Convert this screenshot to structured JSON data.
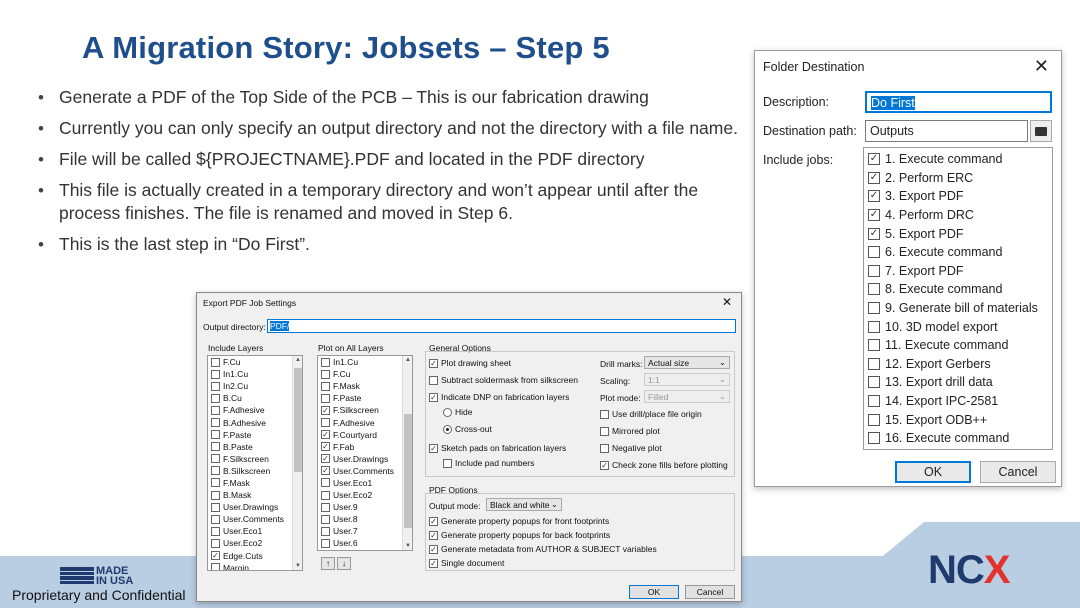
{
  "slide": {
    "title": "A Migration Story: Jobsets – Step 5",
    "bullets": [
      "Generate a PDF of the Top Side of the PCB – This is our fabrication drawing",
      "Currently you can only specify an output directory and not the directory with a file name.",
      "File will be called ${PROJECTNAME}.PDF and located in the PDF directory",
      "This file is actually created in a temporary directory and won’t appear until after the process finishes.  The file is renamed and moved in Step 6.",
      "This is the last step in “Do First”."
    ],
    "footer": {
      "made_line1": "MADE",
      "made_line2": "IN USA",
      "confidential": "Proprietary and Confidential",
      "logo_nc": "NC",
      "logo_x": "X"
    }
  },
  "folder_dialog": {
    "title": "Folder Destination",
    "description_label": "Description:",
    "description_value": "Do First",
    "destination_label": "Destination path:",
    "destination_value": "Outputs",
    "include_label": "Include jobs:",
    "jobs": [
      {
        "label": "1.  Execute command",
        "checked": true
      },
      {
        "label": "2.  Perform ERC",
        "checked": true
      },
      {
        "label": "3.  Export PDF",
        "checked": true
      },
      {
        "label": "4.  Perform DRC",
        "checked": true
      },
      {
        "label": "5.  Export PDF",
        "checked": true
      },
      {
        "label": "6.  Execute command",
        "checked": false
      },
      {
        "label": "7.  Export PDF",
        "checked": false
      },
      {
        "label": "8.  Execute command",
        "checked": false
      },
      {
        "label": "9.  Generate bill of materials",
        "checked": false
      },
      {
        "label": "10.  3D model export",
        "checked": false
      },
      {
        "label": "11.  Execute command",
        "checked": false
      },
      {
        "label": "12.  Export Gerbers",
        "checked": false
      },
      {
        "label": "13.  Export drill data",
        "checked": false
      },
      {
        "label": "14.  Export IPC-2581",
        "checked": false
      },
      {
        "label": "15.  Export ODB++",
        "checked": false
      },
      {
        "label": "16.  Execute command",
        "checked": false
      }
    ],
    "ok_label": "OK",
    "cancel_label": "Cancel"
  },
  "pdf_dialog": {
    "title": "Export PDF Job Settings",
    "output_label": "Output directory:",
    "output_value": "PDF/",
    "include_layers_title": "Include Layers",
    "include_layers": [
      {
        "label": "F.Cu",
        "checked": false
      },
      {
        "label": "In1.Cu",
        "checked": false
      },
      {
        "label": "In2.Cu",
        "checked": false
      },
      {
        "label": "B.Cu",
        "checked": false
      },
      {
        "label": "F.Adhesive",
        "checked": false
      },
      {
        "label": "B.Adhesive",
        "checked": false
      },
      {
        "label": "F.Paste",
        "checked": false
      },
      {
        "label": "B.Paste",
        "checked": false
      },
      {
        "label": "F.Silkscreen",
        "checked": false
      },
      {
        "label": "B.Silkscreen",
        "checked": false
      },
      {
        "label": "F.Mask",
        "checked": false
      },
      {
        "label": "B.Mask",
        "checked": false
      },
      {
        "label": "User.Drawings",
        "checked": false
      },
      {
        "label": "User.Comments",
        "checked": false
      },
      {
        "label": "User.Eco1",
        "checked": false
      },
      {
        "label": "User.Eco2",
        "checked": false
      },
      {
        "label": "Edge.Cuts",
        "checked": true
      },
      {
        "label": "Margin",
        "checked": false
      }
    ],
    "plot_layers_title": "Plot on All Layers",
    "plot_layers": [
      {
        "label": "In1.Cu",
        "checked": false
      },
      {
        "label": "F.Cu",
        "checked": false
      },
      {
        "label": "F.Mask",
        "checked": false
      },
      {
        "label": "F.Paste",
        "checked": false
      },
      {
        "label": "F.Silkscreen",
        "checked": true
      },
      {
        "label": "F.Adhesive",
        "checked": false
      },
      {
        "label": "F.Courtyard",
        "checked": true
      },
      {
        "label": "F.Fab",
        "checked": true
      },
      {
        "label": "User.Drawings",
        "checked": true
      },
      {
        "label": "User.Comments",
        "checked": true
      },
      {
        "label": "User.Eco1",
        "checked": false
      },
      {
        "label": "User.Eco2",
        "checked": false
      },
      {
        "label": "User.9",
        "checked": false
      },
      {
        "label": "User.8",
        "checked": false
      },
      {
        "label": "User.7",
        "checked": false
      },
      {
        "label": "User.6",
        "checked": false
      }
    ],
    "general_title": "General Options",
    "plot_drawing_sheet": "Plot drawing sheet",
    "subtract_soldermask": "Subtract soldermask from silkscreen",
    "indicate_dnp": "Indicate DNP on fabrication layers",
    "hide": "Hide",
    "cross_out": "Cross-out",
    "sketch_pads": "Sketch pads on fabrication layers",
    "include_pad_numbers": "Include pad numbers",
    "drill_marks_label": "Drill marks:",
    "drill_marks_value": "Actual size",
    "scaling_label": "Scaling:",
    "scaling_value": "1:1",
    "plot_mode_label": "Plot mode:",
    "plot_mode_value": "Filled",
    "use_drill_origin": "Use drill/place file origin",
    "mirrored_plot": "Mirrored plot",
    "negative_plot": "Negative plot",
    "check_zone_fills": "Check zone fills before plotting",
    "pdf_title": "PDF Options",
    "output_mode_label": "Output mode:",
    "output_mode_value": "Black and white",
    "popups_front": "Generate property popups for front footprints",
    "popups_back": "Generate property popups for back footprints",
    "metadata": "Generate metadata from AUTHOR & SUBJECT variables",
    "single_document": "Single document",
    "ok_label": "OK",
    "cancel_label": "Cancel"
  }
}
